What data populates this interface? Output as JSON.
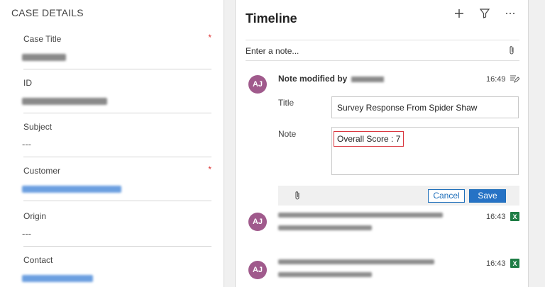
{
  "case_details": {
    "heading": "CASE DETAILS",
    "fields": [
      {
        "label": "Case Title",
        "required": "*",
        "value_style": "gray"
      },
      {
        "label": "ID",
        "required": "",
        "value_style": "gray"
      },
      {
        "label": "Subject",
        "required": "",
        "value": "---"
      },
      {
        "label": "Customer",
        "required": "*",
        "value_style": "blue"
      },
      {
        "label": "Origin",
        "required": "",
        "value": "---"
      },
      {
        "label": "Contact",
        "required": "",
        "value_style": "blue"
      }
    ]
  },
  "timeline": {
    "title": "Timeline",
    "icons": [
      "plus-icon",
      "filter-icon",
      "more-icon"
    ],
    "note_placeholder": "Enter a note...",
    "editing_entry": {
      "avatar": "AJ",
      "heading": "Note modified by",
      "time": "16:49",
      "title_label": "Title",
      "title_value": "Survey Response From Spider Shaw",
      "note_label": "Note",
      "note_value": "Overall Score : 7",
      "cancel_label": "Cancel",
      "save_label": "Save"
    },
    "entries": [
      {
        "avatar": "AJ",
        "time": "16:43",
        "icon": "excel-icon"
      },
      {
        "avatar": "AJ",
        "time": "16:43",
        "icon": "excel-icon"
      }
    ]
  },
  "colors": {
    "avatar": "#a05a8c",
    "accent": "#2672c5",
    "highlight_border": "#d9363e",
    "required": "#d33333",
    "excel": "#1e7d45"
  }
}
